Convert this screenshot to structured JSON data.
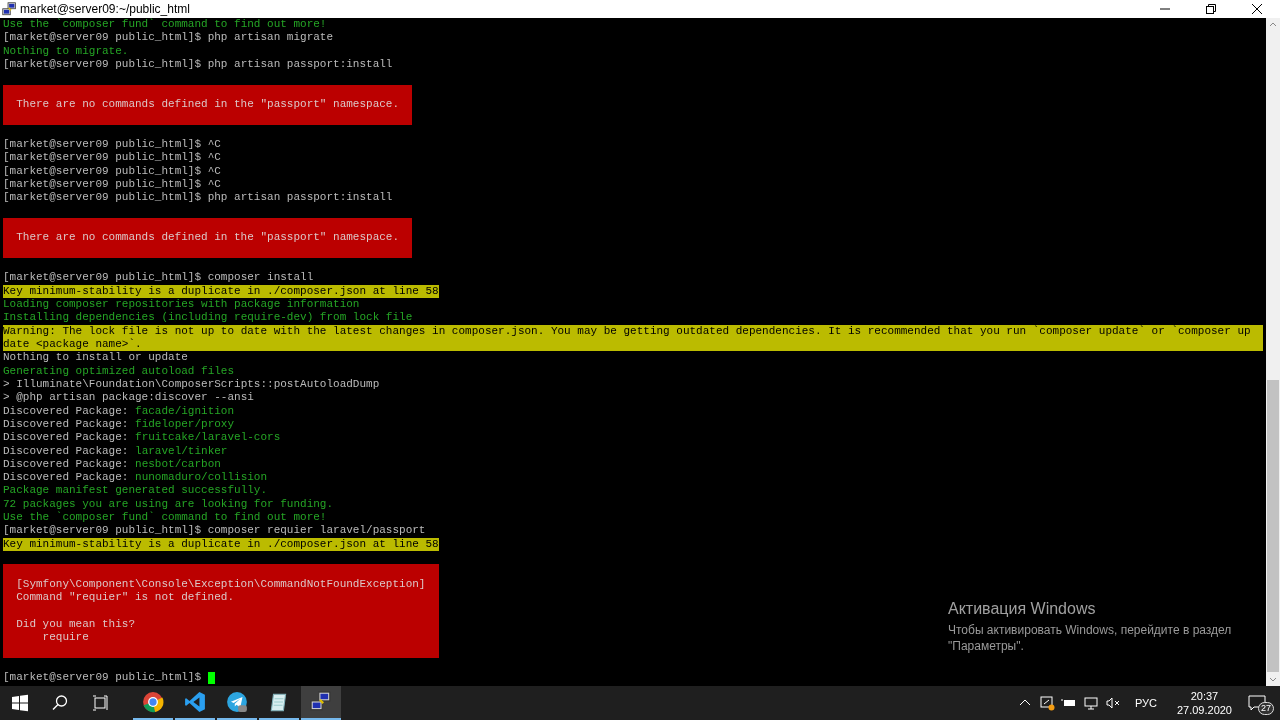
{
  "window": {
    "title": "market@server09:~/public_html"
  },
  "terminal": {
    "lines": [
      {
        "kind": "info",
        "text": "Use the `composer fund` command to find out more!"
      },
      {
        "kind": "prompt",
        "text": "[market@server09 public_html]$ php artisan migrate",
        "cursor": false
      },
      {
        "kind": "info",
        "text": "Nothing to migrate."
      },
      {
        "kind": "prompt",
        "text": "[market@server09 public_html]$ php artisan passport:install",
        "cursor": false
      },
      {
        "kind": "blank"
      },
      {
        "kind": "error",
        "paragraphs": [
          [
            "There are no commands defined in the \"passport\" namespace."
          ]
        ]
      },
      {
        "kind": "blank"
      },
      {
        "kind": "prompt",
        "text": "[market@server09 public_html]$ ^C",
        "cursor": false
      },
      {
        "kind": "prompt",
        "text": "[market@server09 public_html]$ ^C",
        "cursor": false
      },
      {
        "kind": "prompt",
        "text": "[market@server09 public_html]$ ^C",
        "cursor": false
      },
      {
        "kind": "prompt",
        "text": "[market@server09 public_html]$ ^C",
        "cursor": false
      },
      {
        "kind": "prompt",
        "text": "[market@server09 public_html]$ php artisan passport:install",
        "cursor": false
      },
      {
        "kind": "blank"
      },
      {
        "kind": "error",
        "paragraphs": [
          [
            "There are no commands defined in the \"passport\" namespace."
          ]
        ]
      },
      {
        "kind": "blank"
      },
      {
        "kind": "prompt",
        "text": "[market@server09 public_html]$ composer install",
        "cursor": false
      },
      {
        "kind": "notice",
        "text": "Key minimum-stability is a duplicate in ./composer.json at line 58"
      },
      {
        "kind": "info",
        "text": "Loading composer repositories with package information"
      },
      {
        "kind": "info",
        "text": "Installing dependencies (including require-dev) from lock file"
      },
      {
        "kind": "warning",
        "lines": [
          "Warning: The lock file is not up to date with the latest changes in composer.json. You may be getting outdated dependencies. It is recommended that you run `composer update` or `composer up",
          "date <package name>`."
        ]
      },
      {
        "kind": "output",
        "text": "Nothing to install or update"
      },
      {
        "kind": "info",
        "text": "Generating optimized autoload files"
      },
      {
        "kind": "output",
        "text": "> Illuminate\\Foundation\\ComposerScripts::postAutoloadDump"
      },
      {
        "kind": "output",
        "text": "> @php artisan package:discover --ansi"
      },
      {
        "kind": "package",
        "label": "Discovered Package:",
        "name": "facade/ignition"
      },
      {
        "kind": "package",
        "label": "Discovered Package:",
        "name": "fideloper/proxy"
      },
      {
        "kind": "package",
        "label": "Discovered Package:",
        "name": "fruitcake/laravel-cors"
      },
      {
        "kind": "package",
        "label": "Discovered Package:",
        "name": "laravel/tinker"
      },
      {
        "kind": "package",
        "label": "Discovered Package:",
        "name": "nesbot/carbon"
      },
      {
        "kind": "package",
        "label": "Discovered Package:",
        "name": "nunomaduro/collision"
      },
      {
        "kind": "info",
        "text": "Package manifest generated successfully."
      },
      {
        "kind": "info",
        "text": "72 packages you are using are looking for funding."
      },
      {
        "kind": "info",
        "text": "Use the `composer fund` command to find out more!"
      },
      {
        "kind": "prompt",
        "text": "[market@server09 public_html]$ composer requier laravel/passport",
        "cursor": false
      },
      {
        "kind": "notice",
        "text": "Key minimum-stability is a duplicate in ./composer.json at line 58"
      },
      {
        "kind": "blank"
      },
      {
        "kind": "error",
        "paragraphs": [
          [
            "[Symfony\\Component\\Console\\Exception\\CommandNotFoundException]",
            "Command \"requier\" is not defined."
          ],
          [
            "Did you mean this?",
            "    require"
          ]
        ]
      },
      {
        "kind": "blank"
      },
      {
        "kind": "prompt",
        "text": "[market@server09 public_html]$",
        "cursor": true
      }
    ]
  },
  "activation_notice": {
    "title": "Активация Windows",
    "lines": [
      "Чтобы активировать Windows, перейдите в раздел",
      "\"Параметры\"."
    ]
  },
  "taskbar": {
    "apps": [
      {
        "kind": "chrome",
        "selected": false
      },
      {
        "kind": "vscode",
        "selected": false
      },
      {
        "kind": "telegram",
        "selected": false
      },
      {
        "kind": "notepad",
        "selected": false
      },
      {
        "kind": "putty",
        "selected": true
      }
    ],
    "tray": {
      "language": "РУС",
      "time": "20:37",
      "date": "27.09.2020",
      "notifications": "27"
    }
  }
}
